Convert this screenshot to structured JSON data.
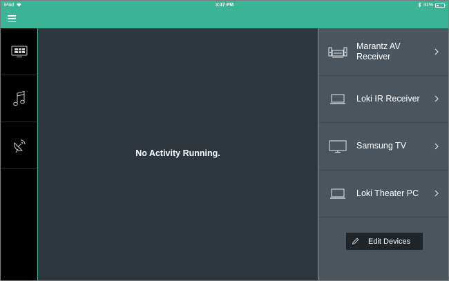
{
  "status_bar": {
    "carrier": "iPad",
    "time": "3:47 PM",
    "battery": "31%",
    "icons": [
      "wifi-icon",
      "bluetooth-icon",
      "battery-icon"
    ]
  },
  "top_bar": {
    "menu_icon": "hamburger-menu-icon"
  },
  "left_nav": {
    "items": [
      {
        "name": "watch",
        "icon": "tv-activity-icon"
      },
      {
        "name": "music",
        "icon": "music-note-icon"
      },
      {
        "name": "satellite",
        "icon": "satellite-dish-icon"
      }
    ]
  },
  "main": {
    "message": "No Activity Running."
  },
  "devices": {
    "items": [
      {
        "label": "Marantz AV Receiver",
        "icon": "av-receiver-icon"
      },
      {
        "label": "Loki IR Receiver",
        "icon": "laptop-icon"
      },
      {
        "label": "Samsung TV",
        "icon": "tv-icon"
      },
      {
        "label": "Loki Theater PC",
        "icon": "laptop-icon"
      }
    ],
    "edit_label": "Edit Devices",
    "edit_icon": "pencil-icon"
  },
  "colors": {
    "accent": "#3bb596",
    "main_bg": "#2e373e",
    "panel_bg": "#4b555e",
    "nav_bg": "#000000",
    "button_bg": "#1f2529"
  }
}
